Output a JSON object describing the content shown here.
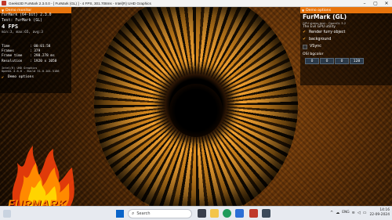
{
  "window": {
    "title": "Geeks3D FurMark 2.3.0.0 - [ FurMark (GL) ] - 4 FPS, 301.708ms - Intel(R) UHD Graphics",
    "min": "–",
    "max": "▢",
    "close": "✕"
  },
  "monitor": {
    "header": "Demo monitor",
    "line1": "FurMark (64-bit) 2.3.0",
    "line2": "Test: FurMark (GL)",
    "fps": "4 FPS",
    "minmax": "min:3, max:65, avg:3",
    "stats": [
      {
        "k": "Time",
        "v": ": 00:01:58"
      },
      {
        "k": "Frames",
        "v": ": 379"
      },
      {
        "k": "Frame time",
        "v": ": 298.278 ms"
      },
      {
        "k": "Resolution",
        "v": ": 1920 x 1050"
      }
    ],
    "gpu": "Intel(R) UHD Graphics",
    "opengl": "OpenGL 4.6.0 - Build 31.0.101.5186",
    "demo_options": "Demo options"
  },
  "logo": {
    "text": "FURMARK"
  },
  "options": {
    "header": "Demo options",
    "brand": "FurMark (GL)",
    "sub1": "GPU stress test - OpenGL 3.2",
    "sub2": "The Evil GPU utility",
    "render_furry": "Render furry object",
    "background": "background",
    "vsync": "VSync",
    "bgcolor_label": "OSI bgcolor",
    "bgcolor": [
      "0",
      "0",
      "0",
      "128"
    ]
  },
  "taskbar": {
    "search_placeholder": "Search",
    "lang": "ENG",
    "region": "IN",
    "time": "14:16",
    "date": "22-09-2024"
  },
  "colors": {
    "accent": "#e8740c",
    "fur_orange": "#f0a030",
    "taskbar": "#e7eaf0"
  }
}
